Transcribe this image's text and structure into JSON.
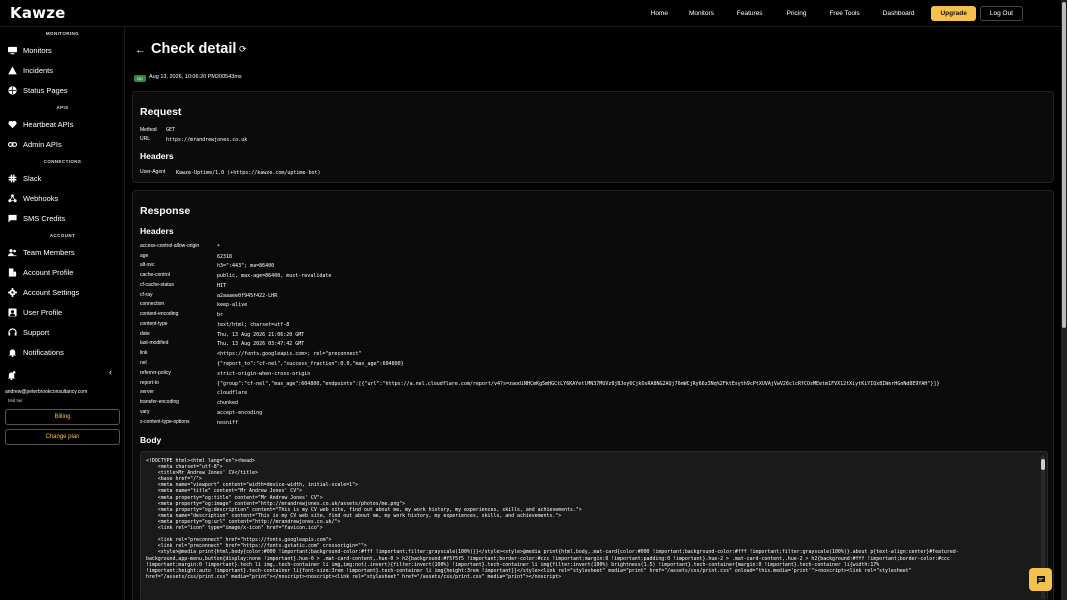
{
  "app": {
    "logo": "Kawze"
  },
  "topnav": {
    "links": [
      "Home",
      "Monitors",
      "Features",
      "Pricing",
      "Free Tools",
      "Dashboard"
    ],
    "upgrade": "Upgrade",
    "logout": "Log Out"
  },
  "sidebar": {
    "sections": [
      "MONITORING",
      "APIS",
      "CONNECTIONS",
      "ACCOUNT"
    ],
    "items": [
      {
        "label": "Monitors",
        "icon": "monitors-icon"
      },
      {
        "label": "Incidents",
        "icon": "warning-icon"
      },
      {
        "label": "Status Pages",
        "icon": "globe-icon"
      },
      {
        "label": "Heartbeat APIs",
        "icon": "heart-icon"
      },
      {
        "label": "Admin APIs",
        "icon": "link-icon"
      },
      {
        "label": "Slack",
        "icon": "slack-icon"
      },
      {
        "label": "Webhooks",
        "icon": "webhook-icon"
      },
      {
        "label": "SMS Credits",
        "icon": "sms-icon"
      },
      {
        "label": "Team Members",
        "icon": "team-icon"
      },
      {
        "label": "Account Profile",
        "icon": "building-icon"
      },
      {
        "label": "Account Settings",
        "icon": "gear-icon"
      },
      {
        "label": "User Profile",
        "icon": "user-icon"
      },
      {
        "label": "Support",
        "icon": "support-icon"
      },
      {
        "label": "Notifications",
        "icon": "bell-icon"
      }
    ],
    "email": "andrew@peterbrookconsultancy.com",
    "tier": "Mid tier",
    "billing": "Billing",
    "change_plan": "Change plan"
  },
  "page": {
    "title": "Check detail",
    "status": "Up",
    "timestamp": "Aug 13, 2026, 10:06:20 PM200543ms"
  },
  "request": {
    "heading": "Request",
    "method_label": "Method",
    "method": "GET",
    "url_label": "URL",
    "url": "https://mrandrewjones.co.uk",
    "headers_heading": "Headers",
    "headers": [
      {
        "name": "User-Agent",
        "value": "Kawze-Uptime/1.0 (+https://kawze.com/uptime-bot)"
      }
    ]
  },
  "response": {
    "heading": "Response",
    "headers_heading": "Headers",
    "headers": [
      {
        "name": "access-control-allow-origin",
        "value": "*"
      },
      {
        "name": "age",
        "value": "62318"
      },
      {
        "name": "alt-svc",
        "value": "h3=\":443\"; ma=86400"
      },
      {
        "name": "cache-control",
        "value": "public, max-age=86400, must-revalidate"
      },
      {
        "name": "cf-cache-status",
        "value": "HIT"
      },
      {
        "name": "cf-ray",
        "value": "a2aaaee0f945f422-LHR"
      },
      {
        "name": "connection",
        "value": "keep-alive"
      },
      {
        "name": "content-encoding",
        "value": "br"
      },
      {
        "name": "content-type",
        "value": "text/html; charset=utf-8"
      },
      {
        "name": "date",
        "value": "Thu, 13 Aug 2026 21:06:20 GMT"
      },
      {
        "name": "last-modified",
        "value": "Thu, 13 Aug 2026 03:47:42 GMT"
      },
      {
        "name": "link",
        "value": "<https://fonts.googleapis.com>; rel=\"preconnect\""
      },
      {
        "name": "nel",
        "value": "{\"report_to\":\"cf-nel\",\"success_fraction\":0.0,\"max_age\":604800}"
      },
      {
        "name": "referrer-policy",
        "value": "strict-origin-when-cross-origin"
      },
      {
        "name": "report-to",
        "value": "{\"group\":\"cf-nel\",\"max_age\":604800,\"endpoints\":[{\"url\":\"https://a.nel.cloudflare.com/report/v4?s=zaodiNHCmKg5mHGCtLY6KAYetlMN37MUVz8jBJoy6CjkOsRA8NG2AQj76mWCjRy66z3Nq%2FktEsyth9cPtXUVAjVwV26clcRfCOsMEetm1FVX12tXiytKiYIQx8IWerHGnNd8E9YAH\"}]}"
      },
      {
        "name": "server",
        "value": "cloudflare"
      },
      {
        "name": "transfer-encoding",
        "value": "chunked"
      },
      {
        "name": "vary",
        "value": "accept-encoding"
      },
      {
        "name": "x-content-type-options",
        "value": "nosniff"
      }
    ],
    "body_heading": "Body",
    "body_lines": [
      "<!DOCTYPE html><html lang=\"en\"><head>",
      "    <meta charset=\"utf-8\">",
      "    <title>Mr Andrew Jones' CV</title>",
      "    <base href=\"/\">",
      "    <meta name=\"viewport\" content=\"width=device-width, initial-scale=1\">",
      "    <meta name=\"title\" content=\"Mr Andrew Jones' CV\">",
      "    <meta property=\"og:title\" content=\"Mr Andrew Jones' CV\">",
      "    <meta property=\"og:image\" content=\"http://mrandrewjones.co.uk/assets/photos/me.png\">",
      "    <meta property=\"og:description\" content=\"This is my CV web site, find out about me, my work history, my experiences, skills, and achievements.\">",
      "    <meta name=\"description\" content=\"This is my CV web site, find out about me, my work history, my experiences, skills, and achievements.\">",
      "    <meta property=\"og:url\" content=\"http://mrandrewjones.co.uk/\">",
      "    <link rel=\"icon\" type=\"image/x-icon\" href=\"favicon.ico\">",
      "",
      "    <link rel=\"preconnect\" href=\"https://fonts.googleapis.com\">",
      "    <link rel=\"preconnect\" href=\"https://fonts.gstatic.com\" crossorigin=\"\">",
      "    <style>@media print{html,body{color:#000 !important;background-color:#fff !important;filter:grayscale(100%)}}</style><style>@media print{html,body,.mat-card{color:#000 !important;background-color:#fff !important;filter:grayscale(100%)}.about p{text-align:center}#featured-",
      "background,app-menu,button{display:none !important}.hue-0 > .mat-card-content,.hue-0 > h2{background:#f5f5f5 !important;border-color:#ccc !important;margin:0 !important;padding:0 !important}.hue-2 > .mat-card-content,.hue-2 > h2{background:#fff !important;border-color:#ccc",
      "!important;margin:0 !important}.tech li img,.tech-container li img,img:not(.invert){filter:invert(100%) !important}.tech-container li img{filter:invert(100%) brightness(1.5) !important}.tech-container{margin:0 !important}.tech-container li{width:17%",
      "!important;height:auto !important}.tech-container li{font-size:3rem !important}.tech-container li img{height:3rem !important}}</style><link rel=\"stylesheet\" media=\"print\" href=\"/assets/css/print.css\" onload=\"this.media='print'\"><noscript><link rel=\"stylesheet\"",
      "href=\"/assets/css/print.css\" media=\"print\"></noscript><noscript><link rel=\"stylesheet\" href=\"/assets/css/print.css\" media=\"print\"></noscript>"
    ]
  },
  "colors": {
    "accent": "#f2c14e",
    "up": "#2b8a3e",
    "background": "#000000",
    "card": "#0b0b0b"
  }
}
